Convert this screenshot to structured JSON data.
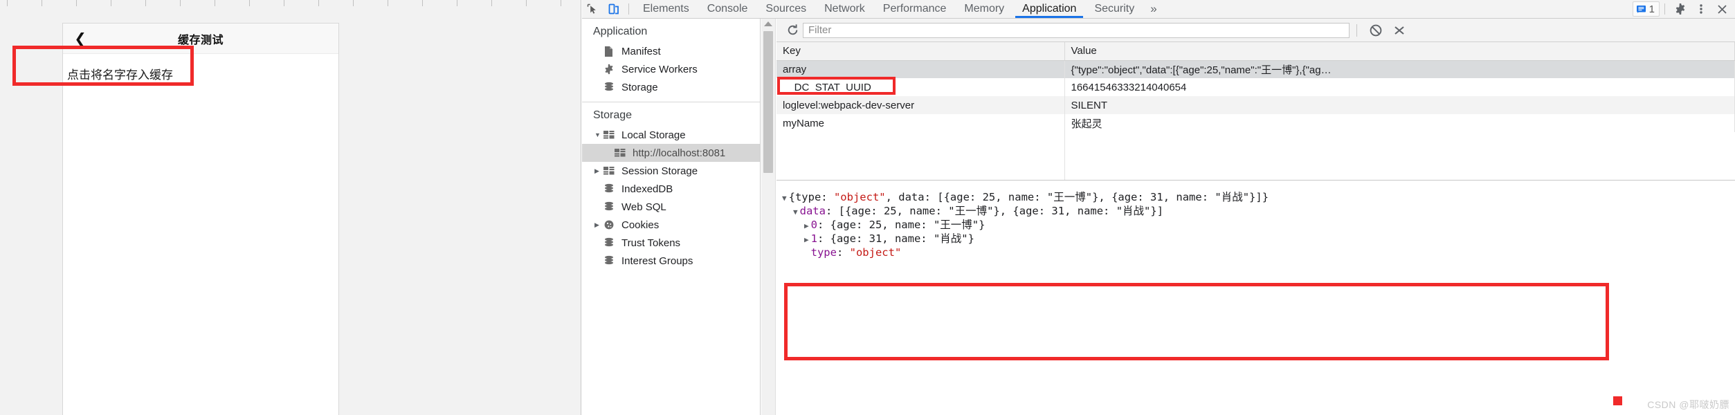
{
  "page": {
    "navbar": {
      "back_icon": "chevron-left-icon",
      "title": "缓存测试"
    },
    "button_label": "点击将名字存入缓存"
  },
  "devtools": {
    "toolbar": {
      "inspect_icon": "inspect-element-icon",
      "device_icon": "device-toolbar-icon",
      "tabs": [
        {
          "label": "Elements",
          "active": false
        },
        {
          "label": "Console",
          "active": false
        },
        {
          "label": "Sources",
          "active": false
        },
        {
          "label": "Network",
          "active": false
        },
        {
          "label": "Performance",
          "active": false
        },
        {
          "label": "Memory",
          "active": false
        },
        {
          "label": "Application",
          "active": true
        },
        {
          "label": "Security",
          "active": false
        }
      ],
      "more_tabs_icon": "chevron-double-right-icon",
      "message_icon": "message-badge-icon",
      "message_count": "1",
      "settings_icon": "gear-icon",
      "menu_icon": "kebab-menu-icon",
      "close_icon": "close-icon",
      "accent_color": "#1a73e8"
    },
    "sidebar": {
      "application_title": "Application",
      "application_items": [
        {
          "label": "Manifest",
          "icon": "manifest-file-icon"
        },
        {
          "label": "Service Workers",
          "icon": "gear-icon"
        },
        {
          "label": "Storage",
          "icon": "database-icon"
        }
      ],
      "storage_title": "Storage",
      "storage_items": [
        {
          "label": "Local Storage",
          "icon": "table-icon",
          "twisty": "▼",
          "selected": false,
          "child": false
        },
        {
          "label": "http://localhost:8081",
          "icon": "table-icon",
          "twisty": "",
          "selected": true,
          "child": true
        },
        {
          "label": "Session Storage",
          "icon": "table-icon",
          "twisty": "▶",
          "selected": false,
          "child": false
        },
        {
          "label": "IndexedDB",
          "icon": "database-icon",
          "twisty": "",
          "selected": false,
          "child": false
        },
        {
          "label": "Web SQL",
          "icon": "database-icon",
          "twisty": "",
          "selected": false,
          "child": false
        },
        {
          "label": "Cookies",
          "icon": "cookie-icon",
          "twisty": "▶",
          "selected": false,
          "child": false
        },
        {
          "label": "Trust Tokens",
          "icon": "database-icon",
          "twisty": "",
          "selected": false,
          "child": false
        },
        {
          "label": "Interest Groups",
          "icon": "database-icon",
          "twisty": "",
          "selected": false,
          "child": false
        }
      ]
    },
    "filter_bar": {
      "refresh_icon": "refresh-icon",
      "filter_placeholder": "Filter",
      "filter_value": "",
      "clear_all_icon": "clear-all-icon",
      "delete_icon": "delete-selected-icon"
    },
    "table": {
      "columns": [
        "Key",
        "Value"
      ],
      "rows": [
        {
          "key": "array",
          "value": "{\"type\":\"object\",\"data\":[{\"age\":25,\"name\":\"王一博\"},{\"ag…",
          "selected": true
        },
        {
          "key": "__DC_STAT_UUID",
          "value": "16641546333214040654",
          "selected": false
        },
        {
          "key": "loglevel:webpack-dev-server",
          "value": "SILENT",
          "selected": false
        },
        {
          "key": "myName",
          "value": "张起灵",
          "selected": false
        }
      ]
    },
    "preview": {
      "lines": [
        {
          "indent": 0,
          "arrow": "▼",
          "parts": [
            {
              "t": "{type: ",
              "c": "tok"
            },
            {
              "t": "\"object\"",
              "c": "v-str"
            },
            {
              "t": ", data: [{age: 25, name: ",
              "c": "tok"
            },
            {
              "t": "\"王一博\"",
              "c": "tok"
            },
            {
              "t": "}, {age: 31, name: ",
              "c": "tok"
            },
            {
              "t": "\"肖战\"",
              "c": "tok"
            },
            {
              "t": "}]}",
              "c": "tok"
            }
          ]
        },
        {
          "indent": 1,
          "arrow": "▼",
          "parts": [
            {
              "t": "data",
              "c": "k-prop"
            },
            {
              "t": ": [{age: 25, name: \"王一博\"}, {age: 31, name: \"肖战\"}]",
              "c": "tok"
            }
          ]
        },
        {
          "indent": 2,
          "arrow": "▶",
          "parts": [
            {
              "t": "0",
              "c": "k-prop"
            },
            {
              "t": ": {age: 25, name: \"王一博\"}",
              "c": "tok"
            }
          ]
        },
        {
          "indent": 2,
          "arrow": "▶",
          "parts": [
            {
              "t": "1",
              "c": "k-prop"
            },
            {
              "t": ": {age: 31, name: \"肖战\"}",
              "c": "tok"
            }
          ]
        },
        {
          "indent": 2,
          "arrow": "",
          "parts": [
            {
              "t": "type",
              "c": "k-prop"
            },
            {
              "t": ": ",
              "c": "tok"
            },
            {
              "t": "\"object\"",
              "c": "v-str"
            }
          ]
        }
      ]
    },
    "annotation_color": "#f02a2a"
  },
  "watermark": "CSDN @耶啵奶膘"
}
